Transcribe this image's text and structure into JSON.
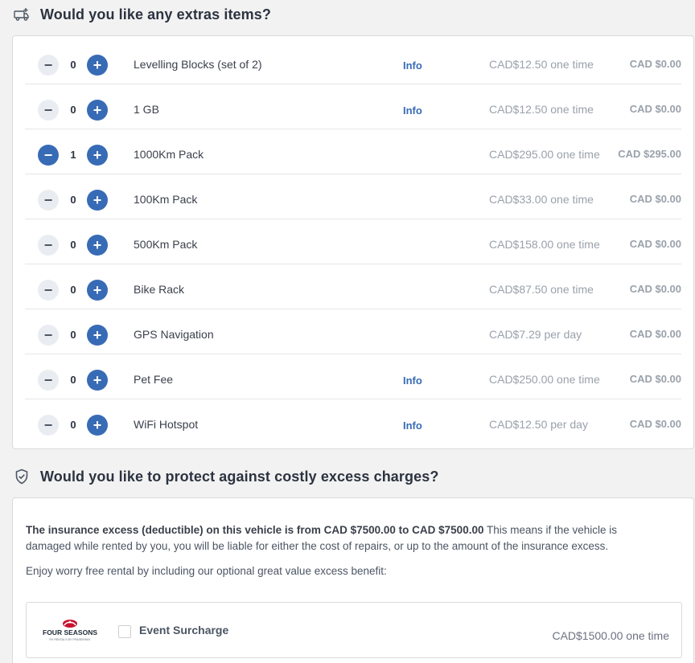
{
  "extras": {
    "title": "Would you like any extras items?",
    "items": [
      {
        "qty": "0",
        "name": "Levelling Blocks (set of 2)",
        "info": "Info",
        "price": "CAD$12.50 one time",
        "total": "CAD $0.00",
        "active": false
      },
      {
        "qty": "0",
        "name": "1 GB",
        "info": "Info",
        "price": "CAD$12.50 one time",
        "total": "CAD $0.00",
        "active": false
      },
      {
        "qty": "1",
        "name": "1000Km Pack",
        "info": "",
        "price": "CAD$295.00 one time",
        "total": "CAD $295.00",
        "active": true
      },
      {
        "qty": "0",
        "name": "100Km Pack",
        "info": "",
        "price": "CAD$33.00 one time",
        "total": "CAD $0.00",
        "active": false
      },
      {
        "qty": "0",
        "name": "500Km Pack",
        "info": "",
        "price": "CAD$158.00 one time",
        "total": "CAD $0.00",
        "active": false
      },
      {
        "qty": "0",
        "name": "Bike Rack",
        "info": "",
        "price": "CAD$87.50 one time",
        "total": "CAD $0.00",
        "active": false
      },
      {
        "qty": "0",
        "name": "GPS Navigation",
        "info": "",
        "price": "CAD$7.29 per day",
        "total": "CAD $0.00",
        "active": false
      },
      {
        "qty": "0",
        "name": "Pet Fee",
        "info": "Info",
        "price": "CAD$250.00 one time",
        "total": "CAD $0.00",
        "active": false
      },
      {
        "qty": "0",
        "name": "WiFi Hotspot",
        "info": "Info",
        "price": "CAD$12.50 per day",
        "total": "CAD $0.00",
        "active": false
      }
    ]
  },
  "protection": {
    "title": "Would you like to protect against costly excess charges?",
    "excess_bold": "The insurance excess (deductible) on this vehicle is from CAD $7500.00 to CAD $7500.00",
    "excess_rest": " This means if the vehicle is damaged while rented by you, you will be liable for either the cost of repairs, or up to the amount of the insurance excess.",
    "enjoy": "Enjoy worry free rental by including our optional great value excess benefit:",
    "option": {
      "logo_text": "FOUR SEASONS",
      "logo_subtext": "RV RENTALS BY FRASERWAY",
      "label": "Event Surcharge",
      "price": "CAD$1500.00 one time",
      "checked": false
    }
  },
  "colors": {
    "accent": "#386bb6",
    "minus_bg": "#e9edf1",
    "logo_red": "#c8102e"
  },
  "icons": {
    "extras": "van-plus-icon",
    "protection": "shield-check-icon",
    "minus": "minus-icon",
    "plus": "plus-icon"
  }
}
